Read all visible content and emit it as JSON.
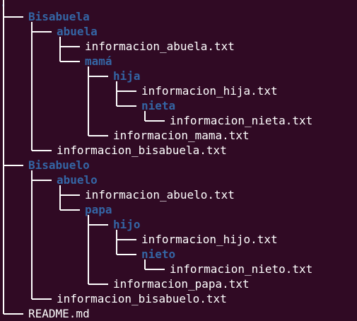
{
  "terminal": {
    "root_label": ".",
    "entries": [
      {
        "name": "Bisabuela",
        "kind": "dir",
        "depth": 0,
        "last": false
      },
      {
        "name": "abuela",
        "kind": "dir",
        "depth": 1,
        "last": false
      },
      {
        "name": "informacion_abuela.txt",
        "kind": "file",
        "depth": 2,
        "last": false
      },
      {
        "name": "mamá",
        "kind": "dir",
        "depth": 2,
        "last": true
      },
      {
        "name": "hija",
        "kind": "dir",
        "depth": 3,
        "last": false
      },
      {
        "name": "informacion_hija.txt",
        "kind": "file",
        "depth": 4,
        "last": false
      },
      {
        "name": "nieta",
        "kind": "dir",
        "depth": 4,
        "last": true
      },
      {
        "name": "informacion_nieta.txt",
        "kind": "file",
        "depth": 5,
        "last": true
      },
      {
        "name": "informacion_mama.txt",
        "kind": "file",
        "depth": 3,
        "last": true
      },
      {
        "name": "informacion_bisabuela.txt",
        "kind": "file",
        "depth": 1,
        "last": true
      },
      {
        "name": "Bisabuelo",
        "kind": "dir",
        "depth": 0,
        "last": false
      },
      {
        "name": "abuelo",
        "kind": "dir",
        "depth": 1,
        "last": false
      },
      {
        "name": "informacion_abuelo.txt",
        "kind": "file",
        "depth": 2,
        "last": false
      },
      {
        "name": "papa",
        "kind": "dir",
        "depth": 2,
        "last": true
      },
      {
        "name": "hijo",
        "kind": "dir",
        "depth": 3,
        "last": false
      },
      {
        "name": "informacion_hijo.txt",
        "kind": "file",
        "depth": 4,
        "last": false
      },
      {
        "name": "nieto",
        "kind": "dir",
        "depth": 4,
        "last": true
      },
      {
        "name": "informacion_nieto.txt",
        "kind": "file",
        "depth": 5,
        "last": true
      },
      {
        "name": "informacion_papa.txt",
        "kind": "file",
        "depth": 3,
        "last": true
      },
      {
        "name": "informacion_bisabuelo.txt",
        "kind": "file",
        "depth": 1,
        "last": true
      },
      {
        "name": "README.md",
        "kind": "file",
        "depth": 0,
        "last": true
      }
    ]
  },
  "colors": {
    "background": "#300a24",
    "directory": "#3465a4",
    "file": "#ffffff",
    "tree_lines": "#ffffff"
  }
}
